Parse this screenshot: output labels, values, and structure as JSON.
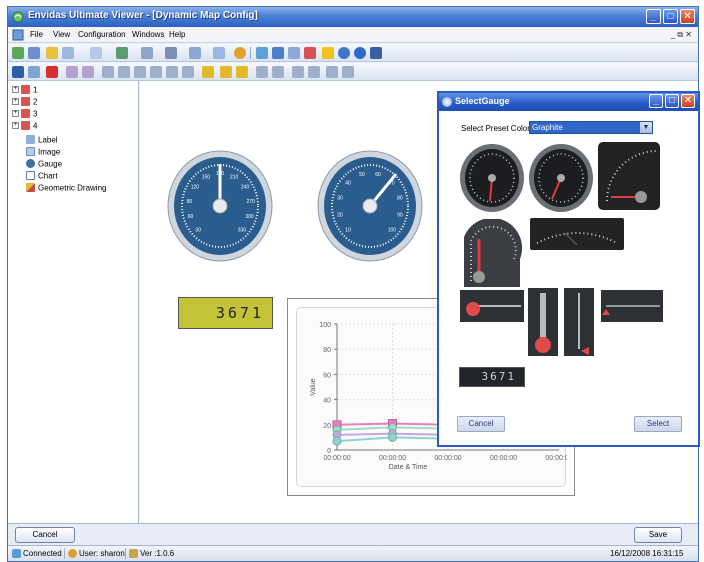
{
  "window": {
    "title": "Envidas Ultimate Viewer - [Dynamic Map Config]",
    "buttons": [
      "_",
      "□",
      "✕"
    ]
  },
  "menu": {
    "items": [
      "File",
      "View",
      "Configuration",
      "Windows",
      "Help"
    ],
    "mdi_controls": "_ ⧉ ✕"
  },
  "tree": {
    "groups": [
      "1",
      "2",
      "3",
      "4"
    ],
    "items": [
      {
        "label": "Label",
        "icon": "label-icon"
      },
      {
        "label": "Image",
        "icon": "image-icon"
      },
      {
        "label": "Gauge",
        "icon": "gauge-icon"
      },
      {
        "label": "Chart",
        "icon": "chart-icon"
      },
      {
        "label": "Geometric Drawing",
        "icon": "geometric-drawing-icon"
      }
    ]
  },
  "canvas": {
    "gauge1": {
      "scale": [
        "30",
        "60",
        "90",
        "120",
        "150",
        "180",
        "210",
        "240",
        "270",
        "300",
        "330"
      ],
      "value_fraction": 0.5
    },
    "gauge2": {
      "scale": [
        "10",
        "20",
        "30",
        "40",
        "50",
        "60",
        "70",
        "80",
        "90",
        "100"
      ],
      "value_fraction": 0.65
    },
    "lcd_value": "3671",
    "chart": {
      "ylabel": "Value",
      "xlabel": "Date & Time",
      "yticks": [
        "0",
        "20",
        "40",
        "60",
        "80",
        "100"
      ],
      "xticks": [
        "00:00:00",
        "00:00:00",
        "00:00:00",
        "00:00:00",
        "00:00:00"
      ]
    }
  },
  "chart_data": {
    "type": "line",
    "x": [
      "00:00:00",
      "00:00:00",
      "00:00:00"
    ],
    "series": [
      {
        "values": [
          20,
          21,
          20
        ],
        "color": "#e87fc0"
      },
      {
        "values": [
          16,
          18,
          17
        ],
        "color": "#9be0c4"
      },
      {
        "values": [
          12,
          13,
          12
        ],
        "color": "#c7a6e0"
      },
      {
        "values": [
          7,
          10,
          9
        ],
        "color": "#8fd4d0"
      }
    ],
    "ylim": [
      0,
      100
    ],
    "ylabel": "Value",
    "xlabel": "Date & Time",
    "grid": true
  },
  "dialog": {
    "title": "SelectGauge",
    "preset_label": "Select Preset Color:",
    "preset_value": "Graphite",
    "thumb_lcd": "3671",
    "cancel": "Cancel",
    "select": "Select"
  },
  "buttons": {
    "cancel": "Cancel",
    "save": "Save"
  },
  "status": {
    "connected": "Connected",
    "user": "User: sharon",
    "version": "Ver :1.0.6",
    "datetime": "16/12/2008 16:31:15"
  },
  "colors": {
    "titlebar": "#2c62bf",
    "gauge_face": "#2a5c8e",
    "lcd_bg": "#c2c435",
    "dialog_border": "#2b5ac1"
  }
}
